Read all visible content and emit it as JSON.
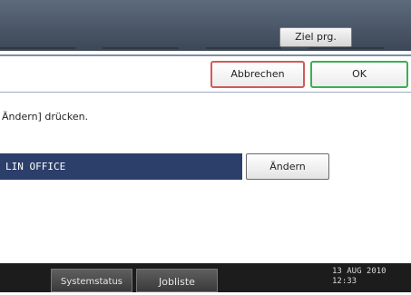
{
  "header": {
    "ziel_button": "Ziel prg."
  },
  "dialog": {
    "cancel_label": "Abbrechen",
    "ok_label": "OK",
    "instruction": "Ändern] drücken.",
    "selected_name": "LIN OFFICE",
    "change_label": "Ändern"
  },
  "status_bar": {
    "system_status_label": "Systemstatus",
    "job_list_label": "Jobliste",
    "date": "13 AUG  2010",
    "time": "12:33"
  }
}
